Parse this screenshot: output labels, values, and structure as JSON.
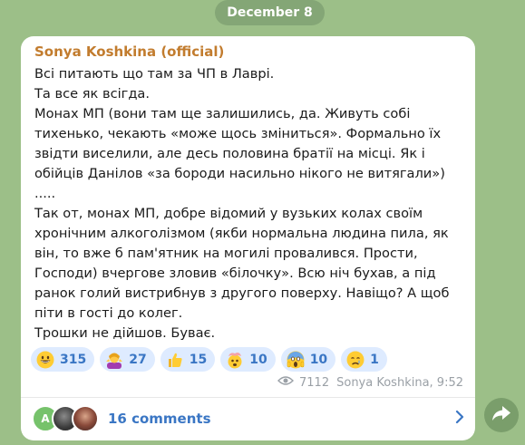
{
  "date_label": "December 8",
  "post": {
    "author": "Sonya Koshkina (official)",
    "lines": [
      "Всі питають що там за ЧП в Лаврі.",
      "Та все як всігда.",
      "Монах МП (вони там ще залишились, да. Живуть собі",
      "тихенько, чекають «може щось зміниться». Формально їх",
      "звідти виселили, але десь половина братії на місці. Як і",
      "обійців Данілов «за бороди насильно нікого не витягали»)",
      ".....",
      "Так от, монах МП, добре відомий у вузьких колах своїм",
      "хронічним алкоголізмом (якби нормальна людина пила, як",
      "він, то вже б пам'ятник на могилі провалився. Прости,",
      "Господи) вчергове зловив «білочку». Всю ніч бухав, а під",
      "ранок голий вистрибнув з другого поверху. Навіщо? А щоб",
      "піти в гості до колег.",
      "Трошки не дійшов. Буває."
    ],
    "reactions": [
      {
        "icon": "grinning-face-icon",
        "count": "315"
      },
      {
        "icon": "woman-shrugging-icon",
        "count": "27"
      },
      {
        "icon": "thumbs-up-icon",
        "count": "15"
      },
      {
        "icon": "exploding-head-icon",
        "count": "10"
      },
      {
        "icon": "screaming-face-icon",
        "count": "10"
      },
      {
        "icon": "crying-face-icon",
        "count": "1"
      }
    ],
    "views": "7112",
    "signature": "Sonya Koshkina, 9:52"
  },
  "comments": {
    "label": "16 comments",
    "first_avatar_letter": "A",
    "avatar_colors": [
      "#76c26b",
      "#3a3a3a",
      "#6b4a3a"
    ]
  },
  "colors": {
    "background": "#9cbf88",
    "author": "#c27c2e",
    "accent": "#3a76c4",
    "reaction_bg": "#deebff"
  }
}
